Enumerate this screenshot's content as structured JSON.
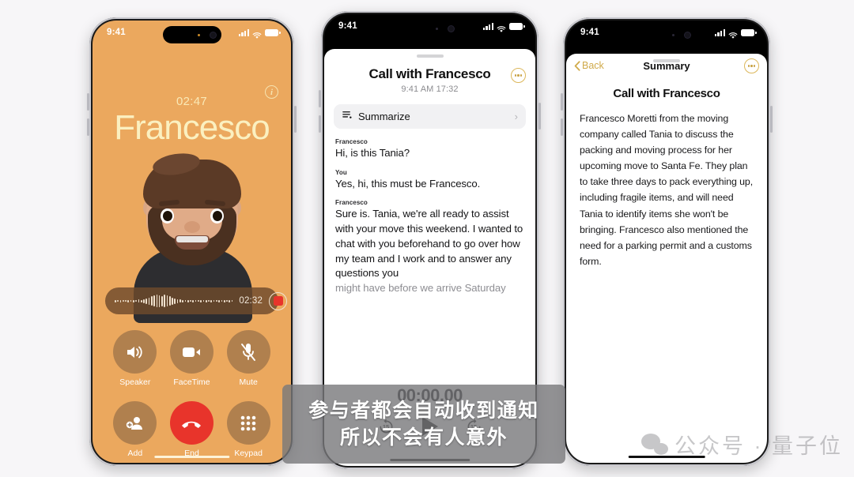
{
  "page": {
    "background_color": "#f7f6f8",
    "accent_gold": "#d0aa4a",
    "call_bg": "#eba85e",
    "end_red": "#e8342b"
  },
  "phone1": {
    "name": "in-call-screen",
    "statusbar": {
      "time": "9:41",
      "signal_icon": "cellular-bars-icon",
      "wifi_icon": "wifi-icon",
      "battery_icon": "battery-icon"
    },
    "info_button": "i",
    "call_duration": "02:47",
    "caller_name": "Francesco",
    "avatar": "memoji-avatar",
    "recording": {
      "waveform": "audio-waveform",
      "elapsed": "02:32",
      "record_button": "record-stop-button"
    },
    "controls": [
      {
        "icon": "speaker-icon",
        "label": "Speaker",
        "name": "speaker-button"
      },
      {
        "icon": "video-icon",
        "label": "FaceTime",
        "name": "facetime-button"
      },
      {
        "icon": "mic-off-icon",
        "label": "Mute",
        "name": "mute-button"
      },
      {
        "icon": "add-person-icon",
        "label": "Add",
        "name": "add-call-button"
      },
      {
        "icon": "end-call-icon",
        "label": "End",
        "name": "end-call-button"
      },
      {
        "icon": "keypad-icon",
        "label": "Keypad",
        "name": "keypad-button"
      }
    ]
  },
  "phone2": {
    "name": "call-transcript-screen",
    "statusbar": {
      "time": "9:41"
    },
    "title": "Call with Francesco",
    "subtitle": "9:41 AM  17:32",
    "more_button": "ellipsis-button",
    "summarize": {
      "icon": "summarize-icon",
      "label": "Summarize",
      "chevron": "›"
    },
    "transcript": [
      {
        "speaker": "Francesco",
        "text": "Hi, is this Tania?",
        "faded": false
      },
      {
        "speaker": "You",
        "text": "Yes, hi, this must be Francesco.",
        "faded": false
      },
      {
        "speaker": "Francesco",
        "text": "Sure is. Tania, we're all ready to assist with your move this weekend. I wanted to chat with you beforehand to go over how my team and I work and to answer any questions you",
        "faded": false
      },
      {
        "speaker": "",
        "text": "might have before we arrive Saturday",
        "faded": true
      }
    ],
    "player": {
      "time": "00:00.00",
      "back_label": "15",
      "forward_label": "15",
      "play_button": "play-button"
    }
  },
  "phone3": {
    "name": "call-summary-screen",
    "statusbar": {
      "time": "9:41"
    },
    "back_label": "Back",
    "nav_title": "Summary",
    "more_button": "ellipsis-button",
    "heading": "Call with Francesco",
    "body": "Francesco Moretti from the moving company called Tania to discuss the packing and moving process for her upcoming move to Santa Fe. They plan to take three days to pack everything up, including fragile items, and will need Tania to identify items she won't be bringing. Francesco also mentioned the need for a parking permit and a customs form."
  },
  "overlay": {
    "subtitle_line1": "参与者都会自动收到通知",
    "subtitle_line2": "所以不会有人意外",
    "watermark_text": "公众号 · 量子位",
    "watermark_icon": "wechat-icon"
  }
}
